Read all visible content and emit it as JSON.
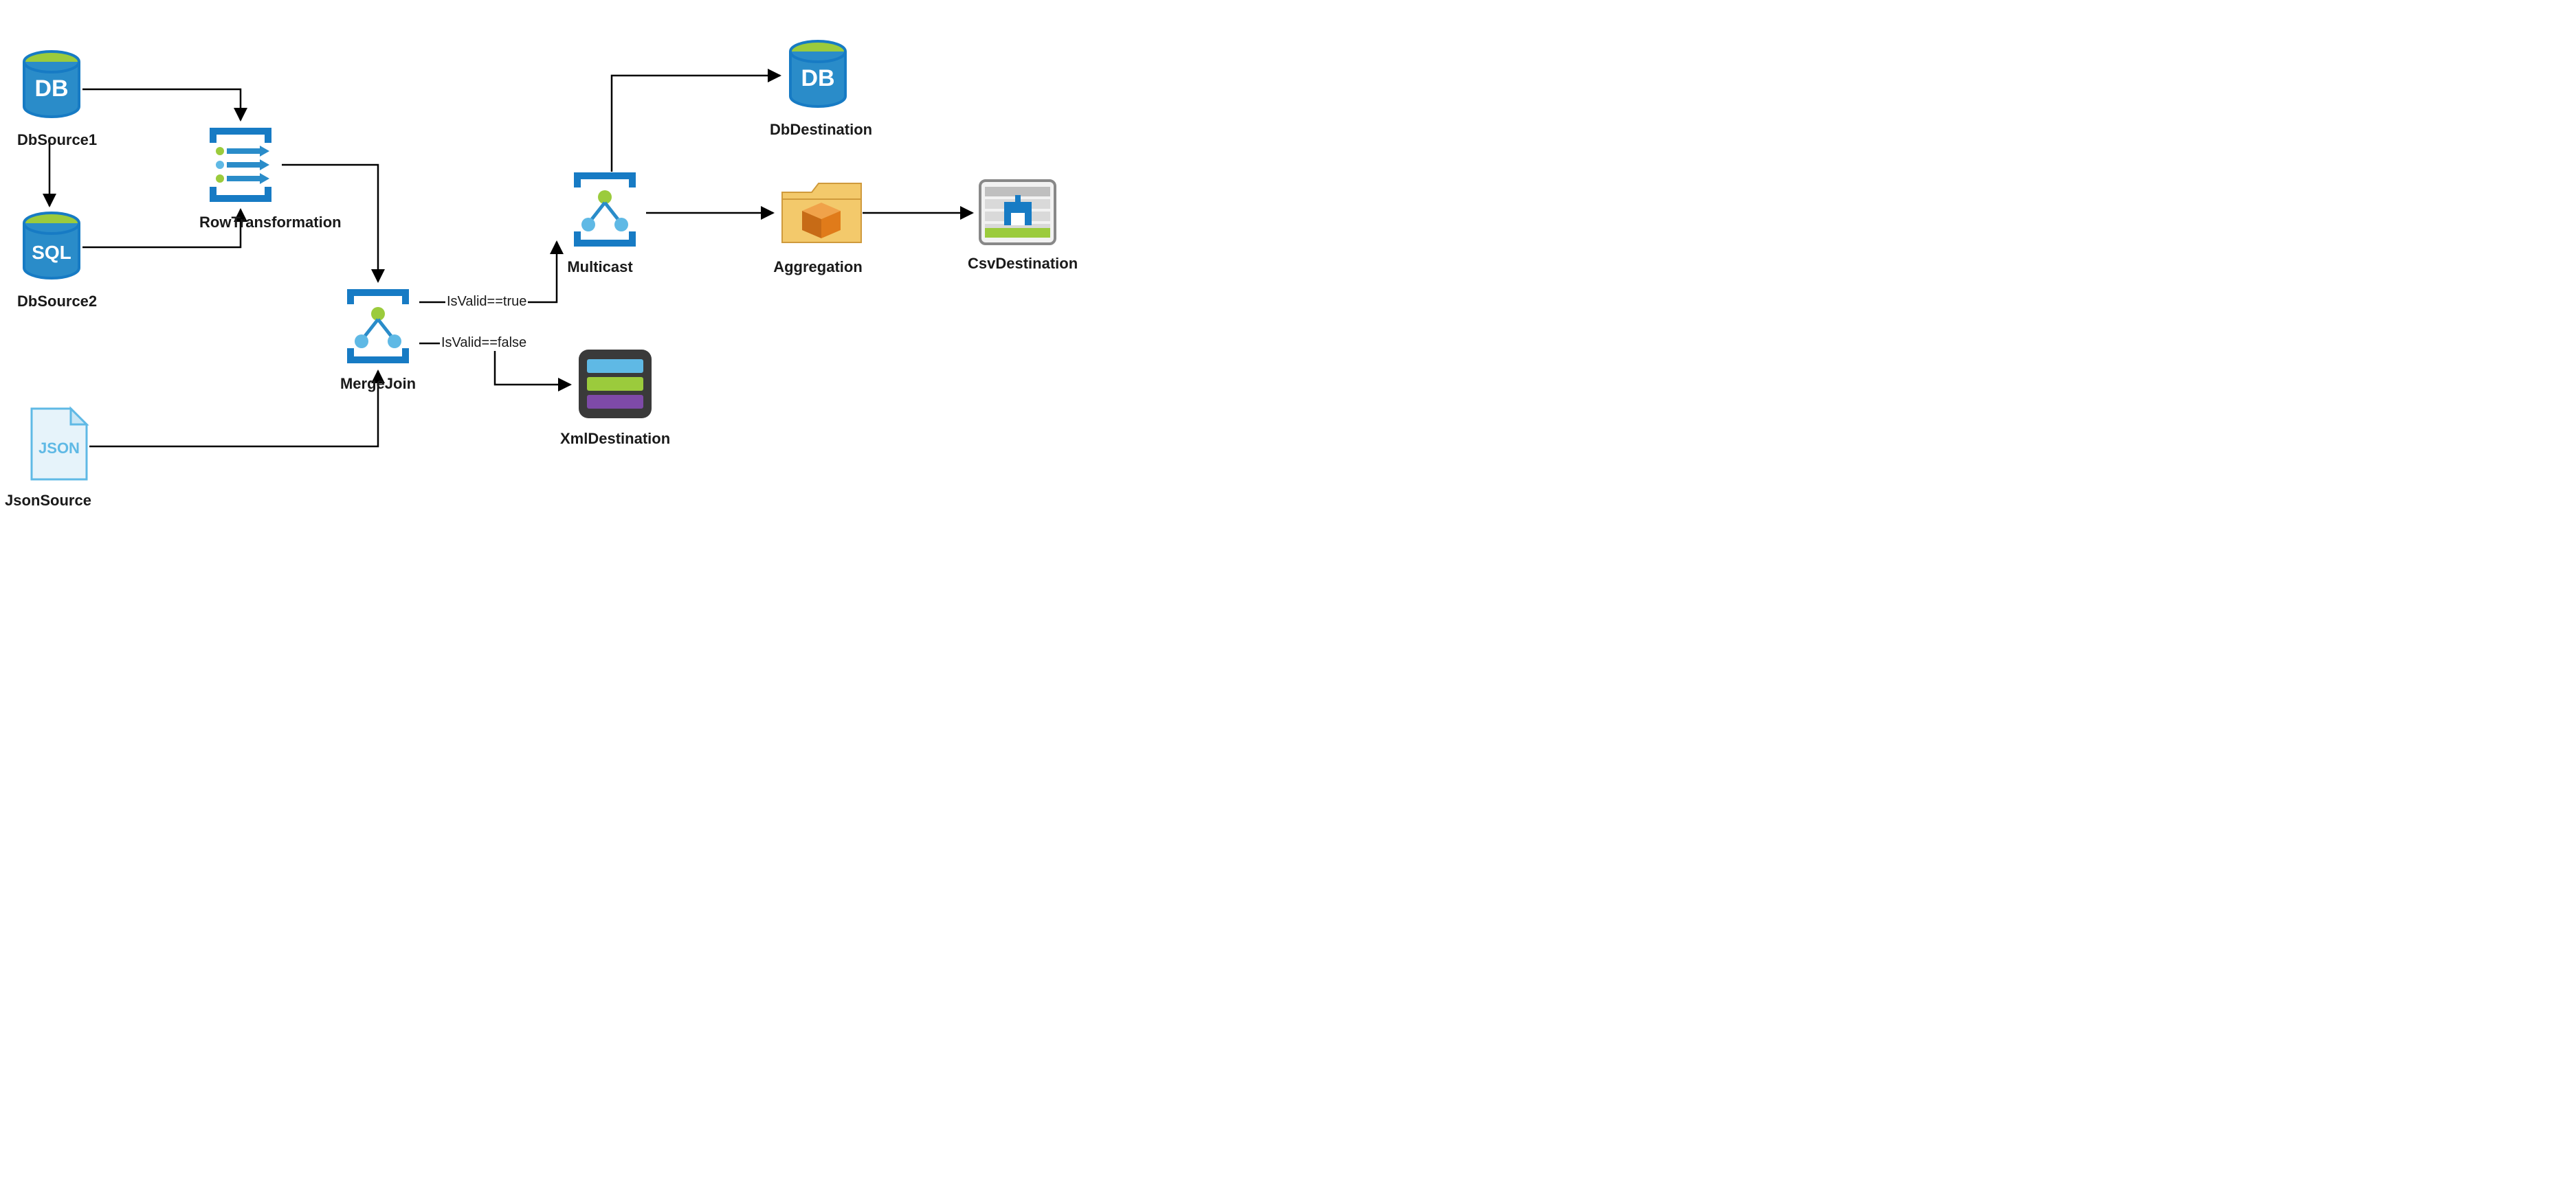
{
  "nodes": {
    "dbsource1": {
      "label": "DbSource1"
    },
    "dbsource2": {
      "label": "DbSource2"
    },
    "rowtrans": {
      "label": "RowTransformation"
    },
    "jsonsource": {
      "label": "JsonSource"
    },
    "mergejoin": {
      "label": "MergeJoin"
    },
    "multicast": {
      "label": "Multicast"
    },
    "dbdest": {
      "label": "DbDestination"
    },
    "aggregation": {
      "label": "Aggregation"
    },
    "csvdest": {
      "label": "CsvDestination"
    },
    "xmldest": {
      "label": "XmlDestination"
    }
  },
  "edgeLabels": {
    "merge_true": "IsValid==true",
    "merge_false": "IsValid==false"
  },
  "colors": {
    "blue": "#177bc4",
    "green": "#9bcb3c",
    "darkBlue": "#0e5a9c",
    "orange": "#e07b1a",
    "folder": "#f3c96b",
    "grey": "#6b6b6b"
  }
}
